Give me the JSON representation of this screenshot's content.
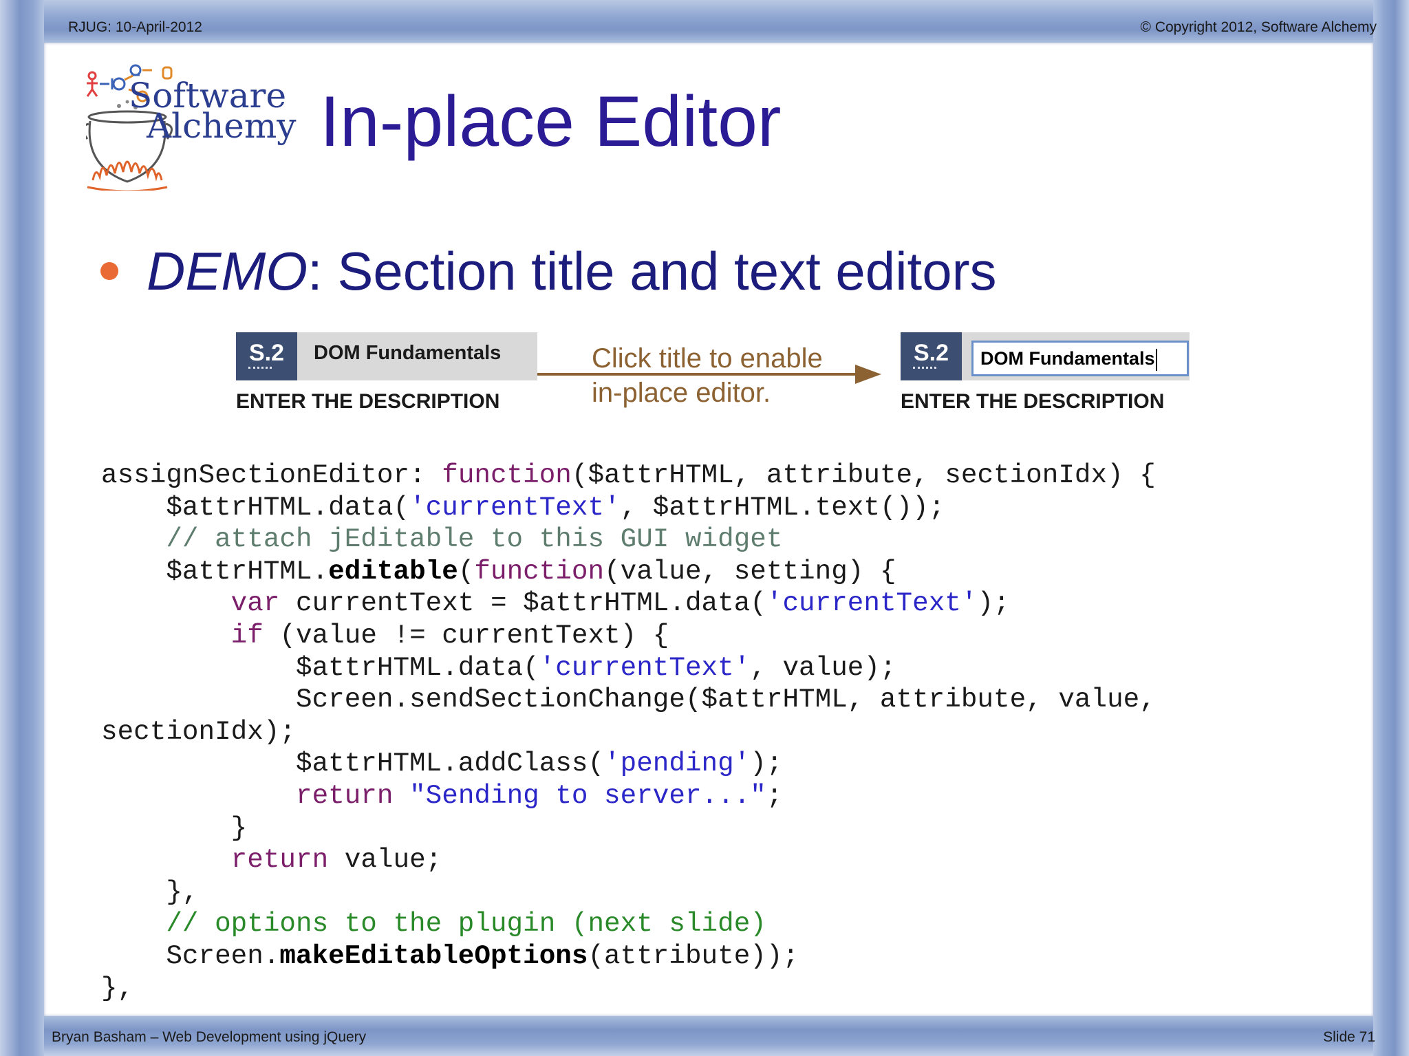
{
  "header": {
    "left": "RJUG:  10-April-2012",
    "right": "© Copyright 2012, Software Alchemy"
  },
  "logo": {
    "line1": "Software",
    "line2": "Alchemy"
  },
  "title": "In-place Editor",
  "bullet": {
    "emphasis": "DEMO",
    "text": ": Section title and text editors"
  },
  "demo": {
    "before": {
      "number": "S.2",
      "title": "DOM Fundamentals",
      "description": "ENTER THE DESCRIPTION"
    },
    "arrow_label": [
      "Click title to enable",
      "in-place editor."
    ],
    "after": {
      "number": "S.2",
      "input_value": "DOM Fundamentals",
      "description": "ENTER THE DESCRIPTION"
    }
  },
  "code_lines": [
    [
      [
        "assignSectionEditor: ",
        ""
      ],
      [
        "function",
        "kw"
      ],
      [
        "($attrHTML, attribute, sectionIdx) {",
        ""
      ]
    ],
    [
      [
        "    $attrHTML.data(",
        ""
      ],
      [
        "'currentText'",
        "str"
      ],
      [
        ", $attrHTML.text());",
        ""
      ]
    ],
    [
      [
        "    // attach jEditable to this GUI widget",
        "cmt-gray"
      ]
    ],
    [
      [
        "    $attrHTML.",
        ""
      ],
      [
        "editable",
        "b"
      ],
      [
        "(",
        ""
      ],
      [
        "function",
        "kw"
      ],
      [
        "(value, setting) {",
        ""
      ]
    ],
    [
      [
        "        ",
        ""
      ],
      [
        "var",
        "kw"
      ],
      [
        " currentText = $attrHTML.data(",
        ""
      ],
      [
        "'currentText'",
        "str"
      ],
      [
        ");",
        ""
      ]
    ],
    [
      [
        "        ",
        ""
      ],
      [
        "if",
        "kw"
      ],
      [
        " (value != currentText) {",
        ""
      ]
    ],
    [
      [
        "            $attrHTML.data(",
        ""
      ],
      [
        "'currentText'",
        "str"
      ],
      [
        ", value);",
        ""
      ]
    ],
    [
      [
        "            Screen.sendSectionChange($attrHTML, attribute, value,",
        ""
      ]
    ],
    [
      [
        "sectionIdx);",
        ""
      ]
    ],
    [
      [
        "            $attrHTML.addClass(",
        ""
      ],
      [
        "'pending'",
        "str"
      ],
      [
        ");",
        ""
      ]
    ],
    [
      [
        "            ",
        ""
      ],
      [
        "return",
        "kw"
      ],
      [
        " ",
        ""
      ],
      [
        "\"Sending to server...\"",
        "str"
      ],
      [
        ";",
        ""
      ]
    ],
    [
      [
        "        }",
        ""
      ]
    ],
    [
      [
        "        ",
        ""
      ],
      [
        "return",
        "kw"
      ],
      [
        " value;",
        ""
      ]
    ],
    [
      [
        "    },",
        ""
      ]
    ],
    [
      [
        "    // options to the plugin (next slide)",
        "cmt-green"
      ]
    ],
    [
      [
        "    Screen.",
        ""
      ],
      [
        "makeEditableOptions",
        "b"
      ],
      [
        "(attribute));",
        ""
      ]
    ],
    [
      [
        "},",
        ""
      ]
    ]
  ],
  "footer": {
    "left": "Bryan Basham – Web Development using jQuery",
    "right": "Slide 71"
  },
  "colors": {
    "title": "#2b1c96",
    "bullet_text": "#1c1c7c",
    "bullet_dot": "#e96a34",
    "frame": "#7d95c6",
    "section_number_bg": "#3c4f72",
    "arrow": "#8d6233",
    "keyword": "#7c1f6a",
    "string": "#2b26c8",
    "comment_gray": "#5e7d6e",
    "comment_green": "#2a8a2a"
  }
}
